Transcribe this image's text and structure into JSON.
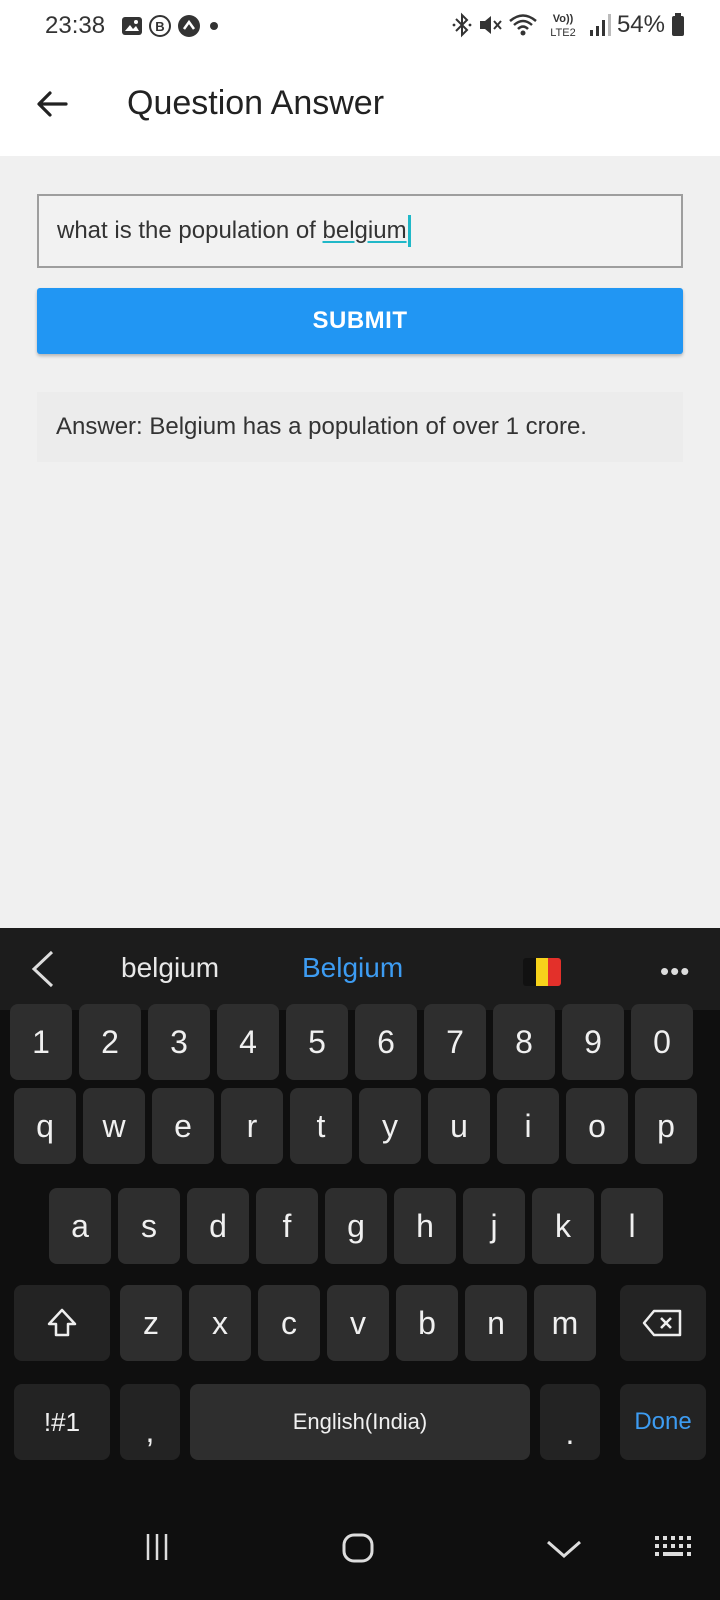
{
  "status_bar": {
    "time": "23:38",
    "battery": "54%",
    "network": "LTE2"
  },
  "app_bar": {
    "title": "Question Answer"
  },
  "form": {
    "question_value": "what is the population of ",
    "question_value_underlined": "belgium",
    "submit_label": "SUBMIT",
    "answer_text": "Answer: Belgium has a population of over 1 crore."
  },
  "keyboard": {
    "suggestions": [
      "belgium",
      "Belgium"
    ],
    "more": "•••",
    "number_row": [
      "1",
      "2",
      "3",
      "4",
      "5",
      "6",
      "7",
      "8",
      "9",
      "0"
    ],
    "row1": [
      "q",
      "w",
      "e",
      "r",
      "t",
      "y",
      "u",
      "i",
      "o",
      "p"
    ],
    "row2": [
      "a",
      "s",
      "d",
      "f",
      "g",
      "h",
      "j",
      "k",
      "l"
    ],
    "row3": [
      "z",
      "x",
      "c",
      "v",
      "b",
      "n",
      "m"
    ],
    "symbols_label": "!#1",
    "comma_label": ",",
    "space_label": "English(India)",
    "period_label": ".",
    "done_label": "Done",
    "accent_color": "#3d9cf2"
  },
  "icons": {
    "status_left": [
      "gallery-icon",
      "b-badge-icon",
      "chevron-up-badge-icon",
      "dot-icon"
    ],
    "status_right": [
      "bluetooth-icon",
      "mute-icon",
      "wifi-icon",
      "volte-icon",
      "signal-icon",
      "battery-icon"
    ],
    "back": "arrow-left-icon",
    "nav": [
      "recents-icon",
      "home-icon",
      "back-chevron-icon",
      "keyboard-grid-icon"
    ]
  }
}
